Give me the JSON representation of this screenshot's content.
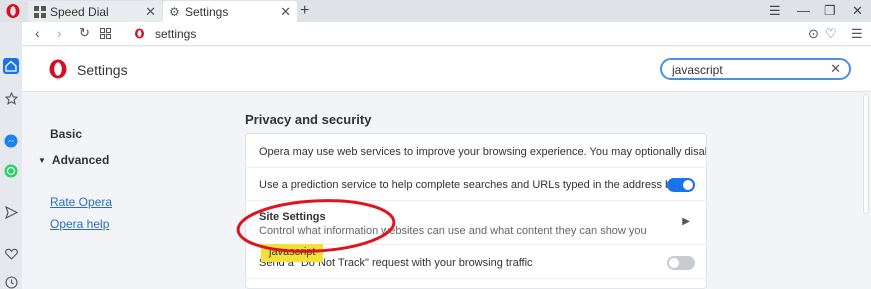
{
  "tabs": [
    {
      "title": "Speed Dial",
      "icon": "speed-dial-icon",
      "active": false
    },
    {
      "title": "Settings",
      "icon": "gear-icon",
      "active": true
    }
  ],
  "address": {
    "url": "settings"
  },
  "header": {
    "title": "Settings"
  },
  "search": {
    "value": "javascript",
    "placeholder": ""
  },
  "nav": {
    "basic": "Basic",
    "advanced": "Advanced",
    "rate": "Rate Opera",
    "help": "Opera help"
  },
  "section": {
    "title": "Privacy and security",
    "rows": [
      {
        "text": "Opera may use web services to improve your browsing experience. You may optionally disable these services."
      },
      {
        "text": "Use a prediction service to help complete searches and URLs typed in the address bar",
        "toggle": true
      },
      {
        "text": "Site Settings",
        "sub": "Control what information websites can use and what content they can show you"
      },
      {
        "text": "Send a \"Do Not Track\" request with your browsing traffic",
        "toggle": false
      }
    ]
  },
  "annotation": {
    "tag": "javascript"
  },
  "colors": {
    "accent": "#1a73e8",
    "opera_red": "#d50f25",
    "annotation_red": "#e0141e",
    "tag_yellow": "#f3e13a"
  }
}
